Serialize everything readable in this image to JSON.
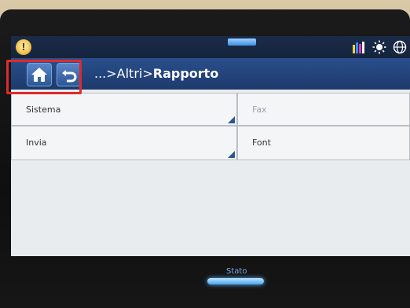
{
  "statusbar": {
    "info_icon_glyph": "!",
    "icons": [
      "supplies-icon",
      "brightness-icon",
      "globe-icon"
    ]
  },
  "toolbar": {
    "breadcrumb_prefix": "...>Altri>",
    "breadcrumb_current": "Rapporto"
  },
  "menu": {
    "items": [
      {
        "label": "Sistema",
        "enabled": true,
        "has_submenu": true,
        "highlighted": true
      },
      {
        "label": "Fax",
        "enabled": false,
        "has_submenu": false
      },
      {
        "label": "Invia",
        "enabled": true,
        "has_submenu": true
      },
      {
        "label": "Font",
        "enabled": true,
        "has_submenu": false
      }
    ]
  },
  "hardware": {
    "status_label": "Stato"
  },
  "colors": {
    "toolbar": "#1d3a6b",
    "highlight": "#e02a2a",
    "status_led": "#46a6ee"
  }
}
